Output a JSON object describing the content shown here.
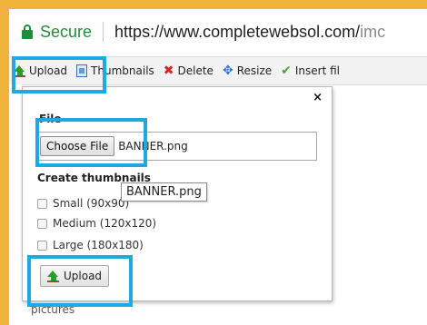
{
  "address_bar": {
    "secure_label": "Secure",
    "url_main": "https://www.completewebsol.com/",
    "url_path": "imc"
  },
  "toolbar": {
    "upload": "Upload",
    "thumbnails": "Thumbnails",
    "delete": "Delete",
    "resize": "Resize",
    "insert": "Insert fil"
  },
  "dialog": {
    "close_symbol": "×",
    "file_label": "File",
    "choose_file_button": "Choose File",
    "chosen_file_name": "BANNER.png",
    "create_thumbnails_label": "Create thumbnails",
    "options": [
      {
        "label": "Small (90x90)",
        "checked": false
      },
      {
        "label": "Medium (120x120)",
        "checked": false
      },
      {
        "label": "Large (180x180)",
        "checked": false
      }
    ],
    "upload_button": "Upload"
  },
  "tooltip": "BANNER.png",
  "background": {
    "tree_item": "pictures"
  },
  "colors": {
    "frame": "#f0b33a",
    "highlight": "#1fa9e1",
    "secure_green": "#1e8e3e"
  }
}
